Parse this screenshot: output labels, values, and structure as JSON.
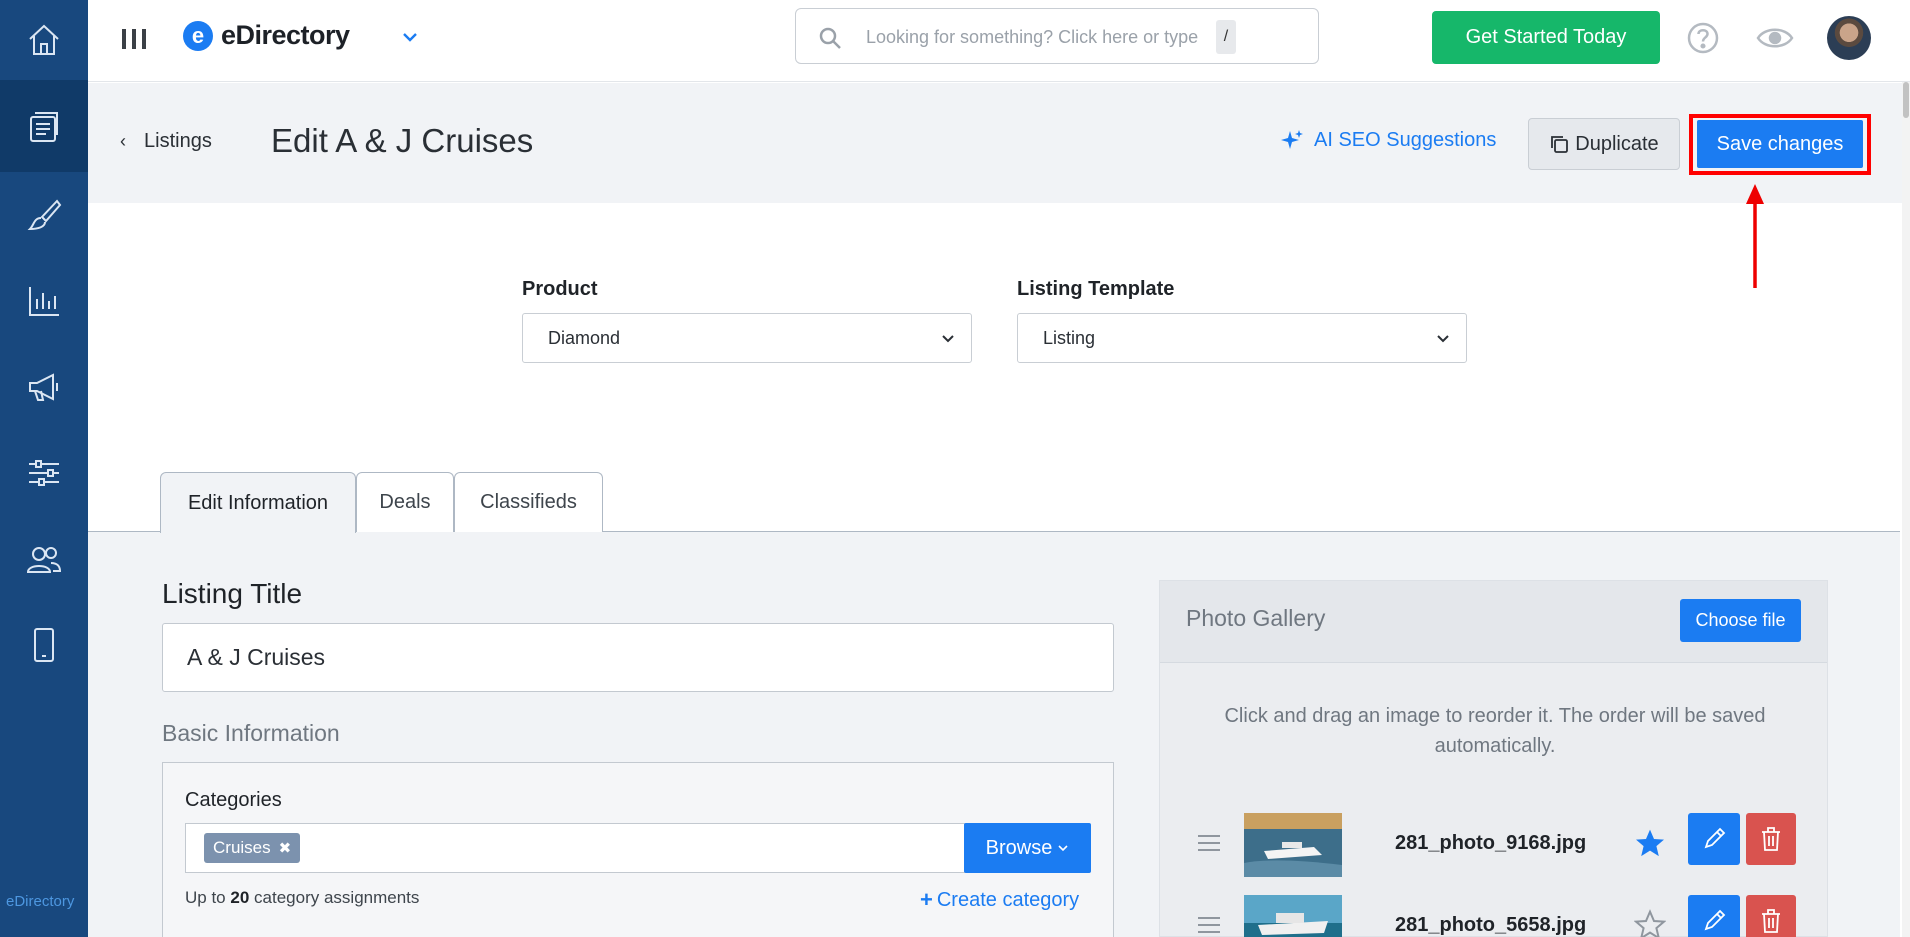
{
  "sidebar": {
    "items": [
      {
        "name": "home-icon"
      },
      {
        "name": "listings-icon",
        "active": true
      },
      {
        "name": "brush-icon"
      },
      {
        "name": "chart-icon"
      },
      {
        "name": "megaphone-icon"
      },
      {
        "name": "sliders-icon"
      },
      {
        "name": "users-icon"
      },
      {
        "name": "mobile-icon"
      }
    ],
    "footer_brand": "eDirectory"
  },
  "topbar": {
    "brand_name": "eDirectory",
    "brand_logo_letter": "e",
    "search": {
      "placeholder": "Looking for something? Click here or type",
      "shortcut": "/"
    },
    "cta_label": "Get Started Today"
  },
  "header": {
    "back_label": "Listings",
    "title": "Edit A & J Cruises",
    "ai_seo_label": "AI SEO Suggestions",
    "duplicate_label": "Duplicate",
    "save_label": "Save changes"
  },
  "form": {
    "product_label": "Product",
    "product_value": "Diamond",
    "template_label": "Listing Template",
    "template_value": "Listing"
  },
  "tabs": [
    {
      "label": "Edit Information",
      "active": true
    },
    {
      "label": "Deals"
    },
    {
      "label": "Classifieds"
    }
  ],
  "listing": {
    "title_label": "Listing Title",
    "title_value": "A & J Cruises",
    "basic_info_heading": "Basic Information",
    "categories_label": "Categories",
    "category_chip": "Cruises",
    "browse_label": "Browse",
    "limit_prefix": "Up to",
    "limit_count": "20",
    "limit_suffix": "category assignments",
    "create_category_label": "Create category"
  },
  "gallery": {
    "title": "Photo Gallery",
    "choose_file_label": "Choose file",
    "hint": "Click and drag an image to reorder it. The order will be saved automatically.",
    "photos": [
      {
        "filename": "281_photo_9168.jpg",
        "featured": true
      },
      {
        "filename": "281_photo_5658.jpg",
        "featured": false
      }
    ]
  },
  "colors": {
    "sidebar": "#18487e",
    "primary": "#1b7cf2",
    "success": "#16b76a",
    "danger": "#d9534f",
    "highlight": "#ff0000"
  }
}
